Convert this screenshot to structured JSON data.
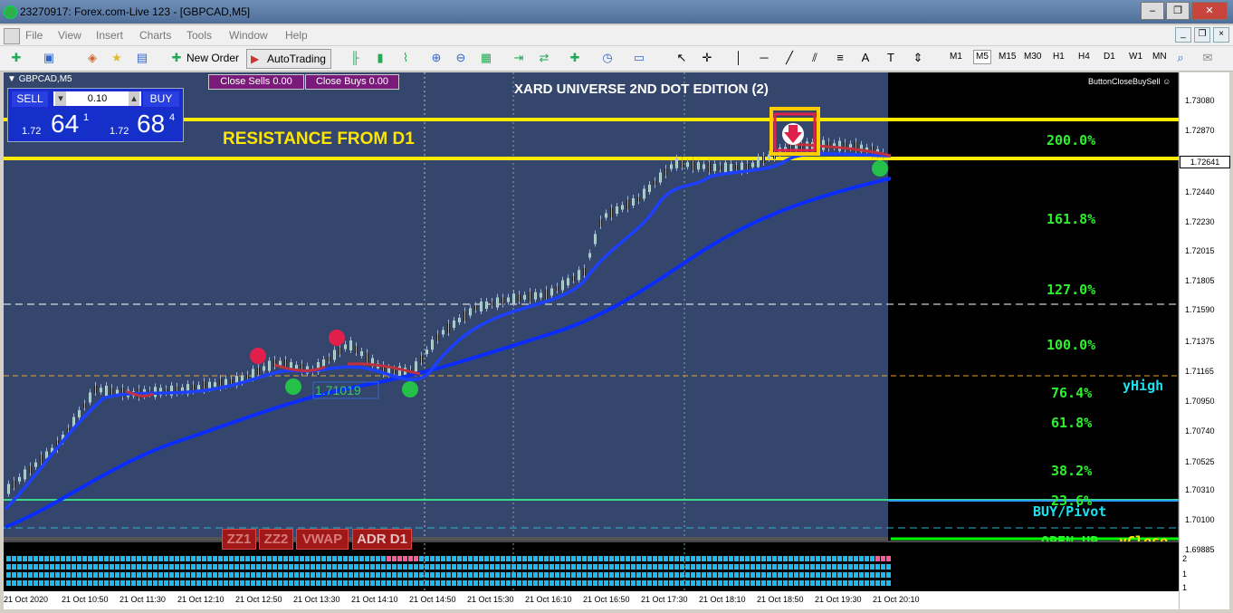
{
  "window": {
    "title": "23270917: Forex.com-Live 123 - [GBPCAD,M5]",
    "buttons": [
      "–",
      "❐",
      "✕"
    ]
  },
  "menu": [
    "File",
    "View",
    "Insert",
    "Charts",
    "Tools",
    "Window",
    "Help"
  ],
  "toolbar": {
    "new_order": "New Order",
    "autotrading": "AutoTrading",
    "timeframes": [
      "M1",
      "M5",
      "M15",
      "M30",
      "H1",
      "H4",
      "D1",
      "W1",
      "MN"
    ],
    "active_timeframe": "M5"
  },
  "chart": {
    "symbol_label": "GBPCAD,M5",
    "title": "XARD UNIVERSE 2ND DOT EDITION (2)",
    "resistance_label": "RESISTANCE FROM D1",
    "button_close_buy_sell": "ButtonCloseBuySell",
    "close_sells": "Close Sells 0.00",
    "close_buys": "Close Buys 0.00",
    "trade_panel": {
      "sell": "SELL",
      "buy": "BUY",
      "lot": "0.10",
      "sell_price_prefix": "1.72",
      "sell_price_big": "64",
      "sell_price_sup": "1",
      "buy_price_prefix": "1.72",
      "buy_price_big": "68",
      "buy_price_sup": "4"
    },
    "bottom_buttons": [
      "ZZ1",
      "ZZ2",
      "VWAP",
      "ADR D1"
    ],
    "level_value_label": "1.71019",
    "fib_levels": [
      "200.0%",
      "161.8%",
      "127.0%",
      "100.0%",
      "76.4%",
      "61.8%",
      "38.2%",
      "23.6%"
    ],
    "side_labels": {
      "yhigh": "yHigh",
      "buy_pivot": "BUY/Pivot",
      "open_up": "OPEN UP",
      "yclose": "yClose"
    },
    "price_axis": [
      "1.73080",
      "1.72870",
      "1.72440",
      "1.72230",
      "1.72015",
      "1.71805",
      "1.71590",
      "1.71375",
      "1.71165",
      "1.70950",
      "1.70740",
      "1.70525",
      "1.70310",
      "1.70100",
      "1.69885"
    ],
    "current_price": "1.72641",
    "indicator_axis": [
      "2",
      "1",
      "1"
    ],
    "time_axis": [
      "21 Oct 2020",
      "21 Oct 10:50",
      "21 Oct 11:30",
      "21 Oct 12:10",
      "21 Oct 12:50",
      "21 Oct 13:30",
      "21 Oct 14:10",
      "21 Oct 14:50",
      "21 Oct 15:30",
      "21 Oct 16:10",
      "21 Oct 16:50",
      "21 Oct 17:30",
      "21 Oct 18:10",
      "21 Oct 18:50",
      "21 Oct 19:30",
      "21 Oct 20:10"
    ]
  }
}
